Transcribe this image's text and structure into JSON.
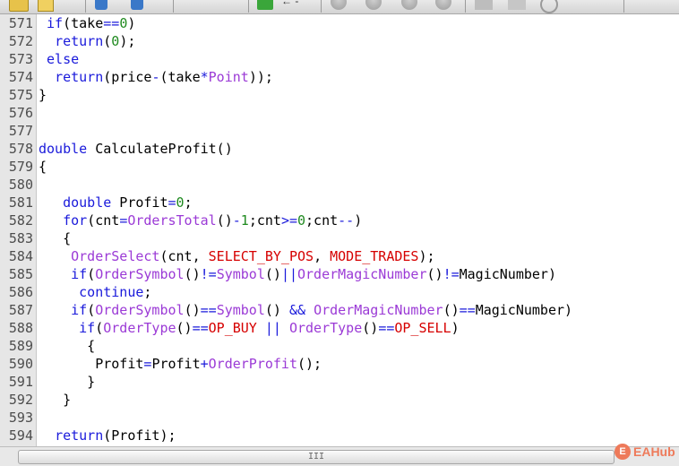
{
  "toolbar": {
    "partial_label": "← -"
  },
  "watermark": {
    "text": "EAHub",
    "logo": "E"
  },
  "scrollbar": {
    "grip": "III"
  },
  "lines": [
    {
      "n": "571",
      "tokens": [
        [
          "txt",
          " "
        ],
        [
          "kw",
          "if"
        ],
        [
          "txt",
          "(take"
        ],
        [
          "op",
          "=="
        ],
        [
          "num",
          "0"
        ],
        [
          "txt",
          ")"
        ]
      ]
    },
    {
      "n": "572",
      "tokens": [
        [
          "txt",
          "  "
        ],
        [
          "kw",
          "return"
        ],
        [
          "txt",
          "("
        ],
        [
          "num",
          "0"
        ],
        [
          "txt",
          ");"
        ]
      ]
    },
    {
      "n": "573",
      "tokens": [
        [
          "txt",
          " "
        ],
        [
          "kw",
          "else"
        ]
      ]
    },
    {
      "n": "574",
      "tokens": [
        [
          "txt",
          "  "
        ],
        [
          "kw",
          "return"
        ],
        [
          "txt",
          "(price"
        ],
        [
          "op",
          "-"
        ],
        [
          "txt",
          "(take"
        ],
        [
          "op",
          "*"
        ],
        [
          "fn",
          "Point"
        ],
        [
          "txt",
          "));"
        ]
      ]
    },
    {
      "n": "575",
      "tokens": [
        [
          "txt",
          "}"
        ]
      ]
    },
    {
      "n": "576",
      "tokens": []
    },
    {
      "n": "577",
      "tokens": []
    },
    {
      "n": "578",
      "tokens": [
        [
          "kw",
          "double"
        ],
        [
          "txt",
          " CalculateProfit()"
        ]
      ]
    },
    {
      "n": "579",
      "tokens": [
        [
          "txt",
          "{"
        ]
      ]
    },
    {
      "n": "580",
      "tokens": []
    },
    {
      "n": "581",
      "tokens": [
        [
          "txt",
          "   "
        ],
        [
          "kw",
          "double"
        ],
        [
          "txt",
          " Profit"
        ],
        [
          "op",
          "="
        ],
        [
          "num",
          "0"
        ],
        [
          "txt",
          ";"
        ]
      ]
    },
    {
      "n": "582",
      "tokens": [
        [
          "txt",
          "   "
        ],
        [
          "kw",
          "for"
        ],
        [
          "txt",
          "(cnt"
        ],
        [
          "op",
          "="
        ],
        [
          "fn",
          "OrdersTotal"
        ],
        [
          "txt",
          "()"
        ],
        [
          "op",
          "-"
        ],
        [
          "num",
          "1"
        ],
        [
          "txt",
          ";cnt"
        ],
        [
          "op",
          ">="
        ],
        [
          "num",
          "0"
        ],
        [
          "txt",
          ";cnt"
        ],
        [
          "op",
          "--"
        ],
        [
          "txt",
          ")"
        ]
      ]
    },
    {
      "n": "583",
      "tokens": [
        [
          "txt",
          "   {"
        ]
      ]
    },
    {
      "n": "584",
      "tokens": [
        [
          "txt",
          "    "
        ],
        [
          "fn",
          "OrderSelect"
        ],
        [
          "txt",
          "(cnt, "
        ],
        [
          "const",
          "SELECT_BY_POS"
        ],
        [
          "txt",
          ", "
        ],
        [
          "const",
          "MODE_TRADES"
        ],
        [
          "txt",
          ");"
        ]
      ]
    },
    {
      "n": "585",
      "tokens": [
        [
          "txt",
          "    "
        ],
        [
          "kw",
          "if"
        ],
        [
          "txt",
          "("
        ],
        [
          "fn",
          "OrderSymbol"
        ],
        [
          "txt",
          "()"
        ],
        [
          "op",
          "!="
        ],
        [
          "fn",
          "Symbol"
        ],
        [
          "txt",
          "()"
        ],
        [
          "op",
          "||"
        ],
        [
          "fn",
          "OrderMagicNumber"
        ],
        [
          "txt",
          "()"
        ],
        [
          "op",
          "!="
        ],
        [
          "txt",
          "MagicNumber)"
        ]
      ]
    },
    {
      "n": "586",
      "tokens": [
        [
          "txt",
          "     "
        ],
        [
          "kw",
          "continue"
        ],
        [
          "txt",
          ";"
        ]
      ]
    },
    {
      "n": "587",
      "tokens": [
        [
          "txt",
          "    "
        ],
        [
          "kw",
          "if"
        ],
        [
          "txt",
          "("
        ],
        [
          "fn",
          "OrderSymbol"
        ],
        [
          "txt",
          "()"
        ],
        [
          "op",
          "=="
        ],
        [
          "fn",
          "Symbol"
        ],
        [
          "txt",
          "() "
        ],
        [
          "op",
          "&&"
        ],
        [
          "txt",
          " "
        ],
        [
          "fn",
          "OrderMagicNumber"
        ],
        [
          "txt",
          "()"
        ],
        [
          "op",
          "=="
        ],
        [
          "txt",
          "MagicNumber)"
        ]
      ]
    },
    {
      "n": "588",
      "tokens": [
        [
          "txt",
          "     "
        ],
        [
          "kw",
          "if"
        ],
        [
          "txt",
          "("
        ],
        [
          "fn",
          "OrderType"
        ],
        [
          "txt",
          "()"
        ],
        [
          "op",
          "=="
        ],
        [
          "const",
          "OP_BUY"
        ],
        [
          "txt",
          " "
        ],
        [
          "op",
          "||"
        ],
        [
          "txt",
          " "
        ],
        [
          "fn",
          "OrderType"
        ],
        [
          "txt",
          "()"
        ],
        [
          "op",
          "=="
        ],
        [
          "const",
          "OP_SELL"
        ],
        [
          "txt",
          ")"
        ]
      ]
    },
    {
      "n": "589",
      "tokens": [
        [
          "txt",
          "      {"
        ]
      ]
    },
    {
      "n": "590",
      "tokens": [
        [
          "txt",
          "       Profit"
        ],
        [
          "op",
          "="
        ],
        [
          "txt",
          "Profit"
        ],
        [
          "op",
          "+"
        ],
        [
          "fn",
          "OrderProfit"
        ],
        [
          "txt",
          "();"
        ]
      ]
    },
    {
      "n": "591",
      "tokens": [
        [
          "txt",
          "      }"
        ]
      ]
    },
    {
      "n": "592",
      "tokens": [
        [
          "txt",
          "   }"
        ]
      ]
    },
    {
      "n": "593",
      "tokens": []
    },
    {
      "n": "594",
      "tokens": [
        [
          "txt",
          "  "
        ],
        [
          "kw",
          "return"
        ],
        [
          "txt",
          "(Profit);"
        ]
      ]
    }
  ]
}
